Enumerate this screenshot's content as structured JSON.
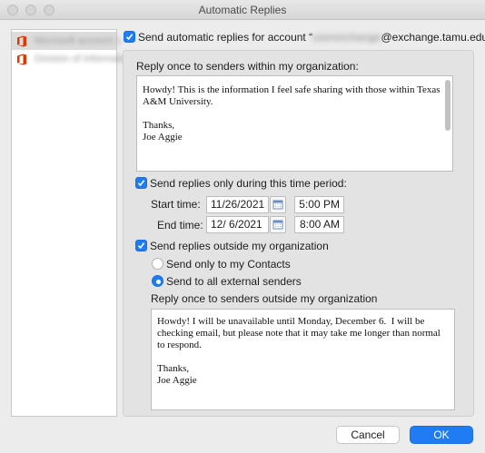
{
  "window": {
    "title": "Automatic Replies"
  },
  "accounts": [
    {
      "label": "Microsoft account 1"
    },
    {
      "label": "Division of Information"
    }
  ],
  "send_auto": {
    "label_prefix": "Send automatic replies for account “",
    "account_hidden": "userexchange",
    "label_suffix": "@exchange.tamu.edu”",
    "checked": true
  },
  "internal": {
    "heading": "Reply once to senders within my organization:",
    "message": "Howdy! This is the information I feel safe sharing with those within Texas A&M University.\n\nThanks,\nJoe Aggie"
  },
  "time_period": {
    "label": "Send replies only during this time period:",
    "checked": true,
    "start_label": "Start time:",
    "start_date": "11/26/2021",
    "start_time": "5:00 PM",
    "end_label": "End time:",
    "end_date": "12/  6/2021",
    "end_time": "8:00 AM"
  },
  "external": {
    "label": "Send replies outside my organization",
    "checked": true,
    "option_contacts": "Send only to my Contacts",
    "option_all": "Send to all external senders",
    "selected": "all",
    "heading": "Reply once to senders outside my organization",
    "message": "Howdy! I will be unavailable until Monday, December 6.  I will be checking email, but please note that it may take me longer than normal to respond.\n\nThanks,\nJoe Aggie"
  },
  "buttons": {
    "cancel": "Cancel",
    "ok": "OK"
  },
  "colors": {
    "accent": "#1f7cf2",
    "office_red": "#d83b01"
  }
}
